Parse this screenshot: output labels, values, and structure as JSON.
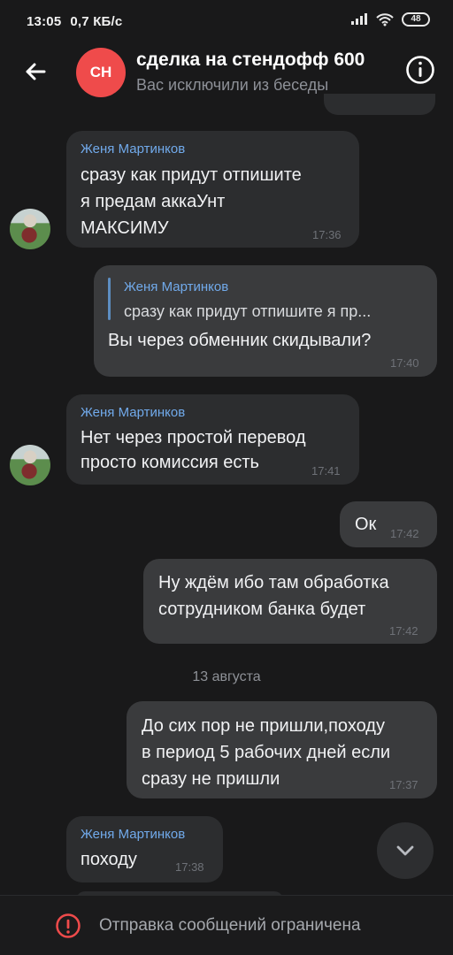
{
  "status_bar": {
    "time": "13:05",
    "network_speed": "0,7 КБ/с",
    "battery": "48"
  },
  "header": {
    "avatar_initials": "СН",
    "title": "сделка на стендофф 600",
    "subtitle": "Вас исключили из беседы"
  },
  "messages": [
    {
      "sender": "Женя Мартинков",
      "lines": [
        "сразу как придут отпишите",
        "я предам аккаУнт",
        "МАКСИМУ"
      ],
      "time": "17:36"
    },
    {
      "quote_sender": "Женя Мартинков",
      "quote_text": "сразу как придут отпишите я пр...",
      "lines": [
        "Вы через обменник скидывали?"
      ],
      "time": "17:40"
    },
    {
      "sender": "Женя Мартинков",
      "lines": [
        "Нет через простой перевод",
        "просто комиссия есть"
      ],
      "time": "17:41"
    },
    {
      "lines": [
        "Ок"
      ],
      "time": "17:42"
    },
    {
      "lines": [
        "Ну ждём ибо там обработка",
        "сотрудником банка будет"
      ],
      "time": "17:42"
    },
    {
      "lines": [
        "До сих пор не пришли,походу",
        "в период 5 рабочих дней если",
        "сразу не пришли"
      ],
      "time": "17:37"
    },
    {
      "sender": "Женя Мартинков",
      "lines": [
        "походу"
      ],
      "time": "17:38"
    }
  ],
  "date_separator": "13 августа",
  "bottom_bar": {
    "text": "Отправка сообщений ограничена"
  },
  "colors": {
    "background": "#19191a",
    "incoming_bubble": "#2c2d2f",
    "outgoing_bubble": "#3a3b3d",
    "sender_blue": "#71aaeb",
    "avatar_red": "#ef4b4b"
  },
  "icons": {
    "back": "arrow-left-icon",
    "info": "info-icon",
    "scroll": "chevron-down-icon",
    "alert": "alert-circle-icon"
  }
}
